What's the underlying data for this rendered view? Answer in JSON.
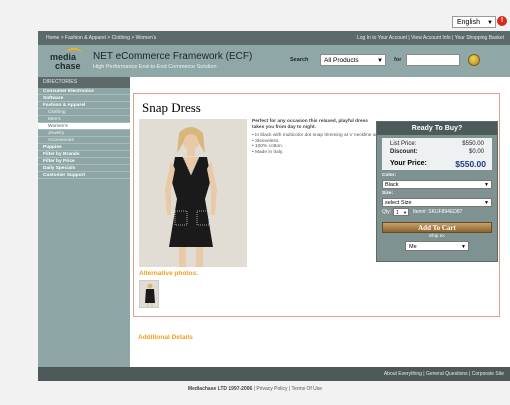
{
  "language": {
    "selected": "English"
  },
  "top_bar": {
    "breadcrumbs": "Home > Fashion & Apparel > Clothing > Women's",
    "links": "Log In to Your Account | View Account Info | Your Shopping Basket"
  },
  "header": {
    "logo_line1": "media",
    "logo_line2": "chase",
    "title": "NET eCommerce Framework (ECF)",
    "subtitle": "High Performance End-to-End Commerce Solution",
    "search_label": "Search",
    "category_value": "All Products",
    "for_label": "for",
    "search_value": ""
  },
  "sidebar": {
    "title": "DIRECTORIES",
    "items": [
      {
        "label": "Consumer Electronics",
        "level": 1
      },
      {
        "label": "Software",
        "level": 1
      },
      {
        "label": "Fashion & Apparel",
        "level": 1
      },
      {
        "label": "Clothing",
        "level": 2
      },
      {
        "label": "Men's",
        "level": 3
      },
      {
        "label": "Women's",
        "level": 3,
        "active": true
      },
      {
        "label": "Jewelry",
        "level": 2
      },
      {
        "label": "Accessories",
        "level": 2
      },
      {
        "label": "Puppies",
        "level": 1
      },
      {
        "label": "Filter by Brands",
        "level": 1
      },
      {
        "label": "Filter by Price",
        "level": 1
      },
      {
        "label": "Daily Specials",
        "level": 1
      },
      {
        "label": "Customer Support",
        "level": 1
      }
    ]
  },
  "product": {
    "title": "Snap Dress",
    "description_lead": "Perfect for any occasion this relaxed, playful dress takes you from day to night.",
    "bullets": [
      "In black with multicolor dot snap trimming at V neckline and patch pockets.",
      "Sleeveless.",
      "100% cotton.",
      "Made in Italy."
    ],
    "alt_photos_title": "Alternative photos:",
    "additional_details_title": "Additional Details"
  },
  "buy_box": {
    "title": "Ready To Buy?",
    "list_price_label": "List Price:",
    "list_price": "$550.00",
    "discount_label": "Discount:",
    "discount": "$0.00",
    "your_price_label": "Your Price:",
    "your_price": "$550.00",
    "color_label": "Color:",
    "color_value": "Black",
    "size_label": "Size:",
    "size_value": "select Size",
    "qty_label": "Qty:",
    "qty_value": "1",
    "item_number": "Item#: SKUF894ED87",
    "add_to_cart": "Add To Cart",
    "ship_to_label": "Ship to:",
    "ship_to_value": "Me"
  },
  "footer": {
    "links": "About Everything | General Questions | Corporate Site",
    "copyright_company": "Mediachase LTD 1997-2006",
    "copyright_links": "| Privacy Policy | Terms Of Use"
  },
  "colors": {
    "header_bg": "#8fa7a7",
    "dark_bar": "#5c6a6a",
    "accent_orange": "#f0a020",
    "price_blue": "#1c3a8a",
    "panel_border": "#e0a090"
  }
}
